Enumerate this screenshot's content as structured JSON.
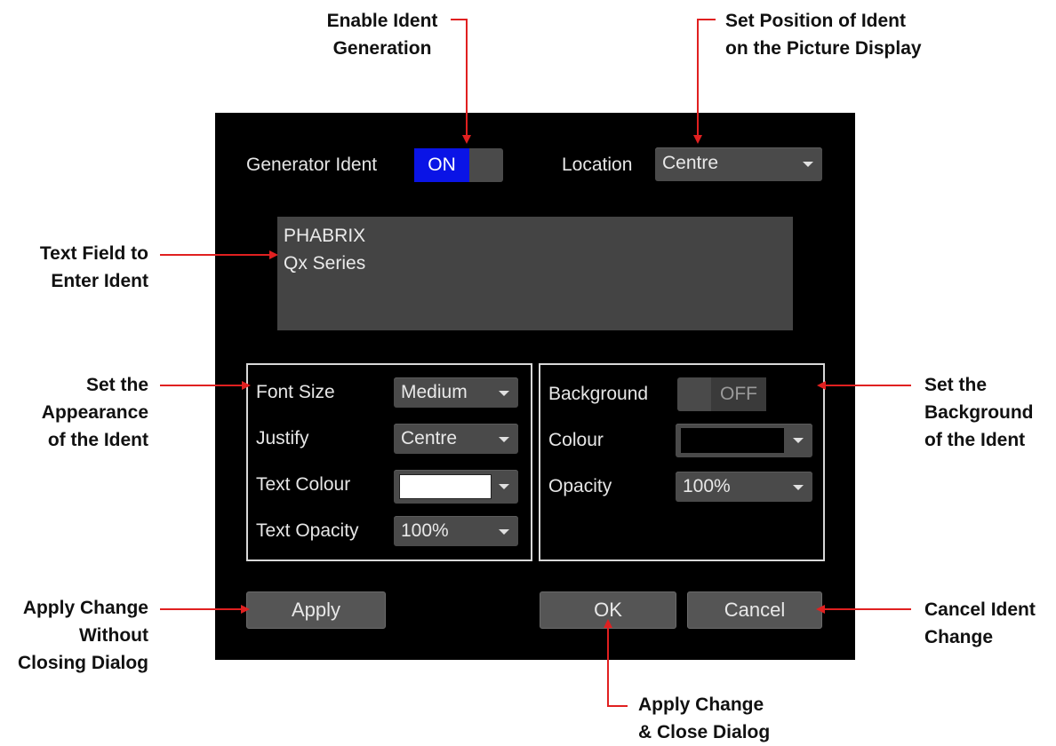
{
  "callouts": {
    "enable_ident": [
      "Enable Ident",
      "Generation"
    ],
    "set_position": [
      "Set Position of Ident",
      "on the Picture Display"
    ],
    "text_field": [
      "Text Field to",
      "Enter Ident"
    ],
    "appearance": [
      "Set the",
      "Appearance",
      "of the Ident"
    ],
    "background": [
      "Set the",
      "Background",
      "of the Ident"
    ],
    "apply_change": [
      "Apply Change",
      "Without",
      "Closing Dialog"
    ],
    "cancel_ident": [
      "Cancel Ident",
      "Change"
    ],
    "apply_close": [
      "Apply Change",
      "& Close Dialog"
    ]
  },
  "dialog": {
    "generator_ident": {
      "label": "Generator Ident",
      "state": "ON"
    },
    "location": {
      "label": "Location",
      "value": "Centre"
    },
    "ident_text": [
      "PHABRIX",
      "Qx Series"
    ],
    "appearance": {
      "font_size": {
        "label": "Font Size",
        "value": "Medium"
      },
      "justify": {
        "label": "Justify",
        "value": "Centre"
      },
      "text_colour": {
        "label": "Text Colour",
        "value": "#ffffff"
      },
      "text_opacity": {
        "label": "Text Opacity",
        "value": "100%"
      }
    },
    "background": {
      "toggle": {
        "label": "Background",
        "state": "OFF"
      },
      "colour": {
        "label": "Colour",
        "value": "#000000"
      },
      "opacity": {
        "label": "Opacity",
        "value": "100%"
      }
    },
    "buttons": {
      "apply": "Apply",
      "ok": "OK",
      "cancel": "Cancel"
    }
  },
  "colors": {
    "arrow": "#e02020",
    "toggle_on": "#0a14e6",
    "dialog_bg": "#000000"
  }
}
